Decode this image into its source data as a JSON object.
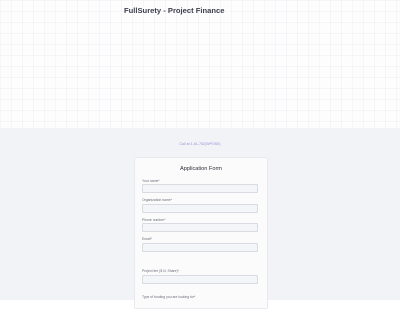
{
  "hero": {
    "title": "FullSurety - Project Finance"
  },
  "link_text": "Call at 1-61-752(WPOSS)",
  "form": {
    "title": "Application Form",
    "fields": [
      {
        "label": "Your name*"
      },
      {
        "label": "Organization name*"
      },
      {
        "label": "Phone number*"
      },
      {
        "label": "Email*"
      },
      {
        "label": "Project fee ($ N, Share)*"
      },
      {
        "label": "Type of funding you are looking for*"
      }
    ]
  }
}
